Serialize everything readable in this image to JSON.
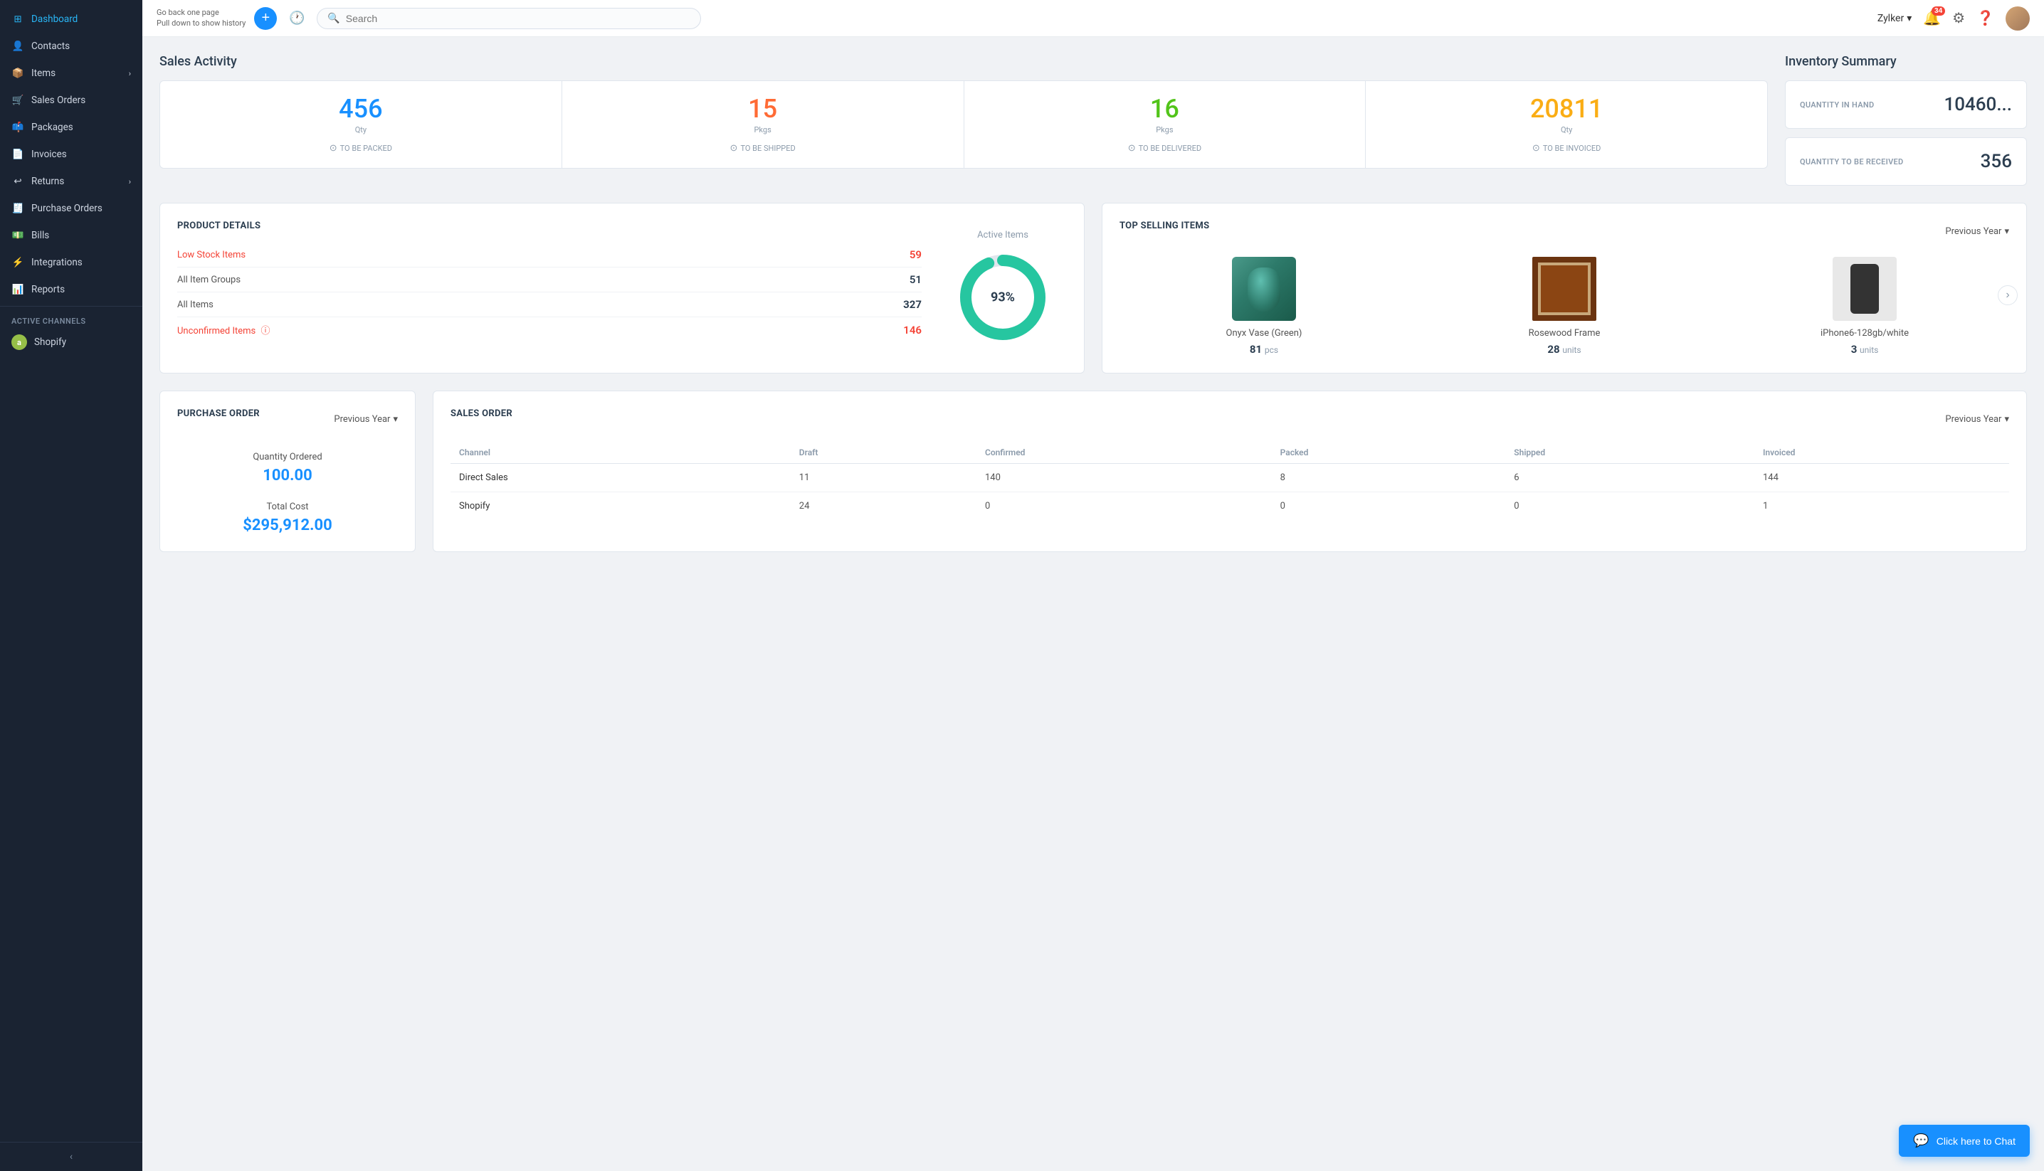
{
  "sidebar": {
    "nav_hint": "Go back one page\nPull down to show history",
    "items": [
      {
        "id": "dashboard",
        "label": "Dashboard",
        "icon": "grid",
        "active": true
      },
      {
        "id": "contacts",
        "label": "Contacts",
        "icon": "person"
      },
      {
        "id": "items",
        "label": "Items",
        "icon": "box",
        "hasSubmenu": true
      },
      {
        "id": "sales-orders",
        "label": "Sales Orders",
        "icon": "cart"
      },
      {
        "id": "packages",
        "label": "Packages",
        "icon": "package"
      },
      {
        "id": "invoices",
        "label": "Invoices",
        "icon": "file"
      },
      {
        "id": "returns",
        "label": "Returns",
        "icon": "return",
        "hasSubmenu": true
      },
      {
        "id": "purchase-orders",
        "label": "Purchase Orders",
        "icon": "purchase"
      },
      {
        "id": "bills",
        "label": "Bills",
        "icon": "bill"
      },
      {
        "id": "integrations",
        "label": "Integrations",
        "icon": "integration"
      },
      {
        "id": "reports",
        "label": "Reports",
        "icon": "report"
      }
    ],
    "active_channels_label": "ACTIVE CHANNELS",
    "channels": [
      {
        "id": "shopify",
        "label": "Shopify",
        "icon": "shopify"
      }
    ],
    "collapse_label": "‹"
  },
  "header": {
    "search_placeholder": "Search",
    "user_name": "Zylker",
    "notification_count": "34",
    "add_button_label": "+",
    "back_hint": "Go back one page\nPull down to show history"
  },
  "sales_activity": {
    "title": "Sales Activity",
    "cards": [
      {
        "number": "456",
        "label": "Qty",
        "status": "TO BE PACKED",
        "color": "blue"
      },
      {
        "number": "15",
        "label": "Pkgs",
        "status": "TO BE SHIPPED",
        "color": "orange"
      },
      {
        "number": "16",
        "label": "Pkgs",
        "status": "TO BE DELIVERED",
        "color": "green"
      },
      {
        "number": "20811",
        "label": "Qty",
        "status": "TO BE INVOICED",
        "color": "gold"
      }
    ]
  },
  "inventory_summary": {
    "title": "Inventory Summary",
    "items": [
      {
        "label": "QUANTITY IN HAND",
        "value": "10460..."
      },
      {
        "label": "QUANTITY TO BE RECEIVED",
        "value": "356"
      }
    ]
  },
  "product_details": {
    "title": "PRODUCT DETAILS",
    "rows": [
      {
        "label": "Low Stock Items",
        "value": "59",
        "label_type": "red-link",
        "value_type": "red"
      },
      {
        "label": "All Item Groups",
        "value": "51",
        "label_type": "normal",
        "value_type": "normal"
      },
      {
        "label": "All Items",
        "value": "327",
        "label_type": "normal",
        "value_type": "bold"
      },
      {
        "label": "Unconfirmed Items",
        "value": "146",
        "label_type": "red-link",
        "value_type": "red",
        "has_info": true
      }
    ],
    "donut": {
      "label": "Active Items",
      "percent": 93,
      "percent_label": "93%",
      "color_active": "#26c6a0",
      "color_inactive": "#e0e6ed"
    }
  },
  "top_selling": {
    "title": "TOP SELLING ITEMS",
    "period": "Previous Year",
    "items": [
      {
        "name": "Onyx Vase (Green)",
        "qty": "81",
        "unit": "pcs",
        "image_type": "vase"
      },
      {
        "name": "Rosewood Frame",
        "qty": "28",
        "unit": "units",
        "image_type": "frame"
      },
      {
        "name": "iPhone6-128gb/white",
        "qty": "3",
        "unit": "units",
        "image_type": "phone"
      }
    ]
  },
  "purchase_order": {
    "title": "PURCHASE ORDER",
    "period": "Previous Year",
    "metrics": [
      {
        "label": "Quantity Ordered",
        "value": "100.00"
      },
      {
        "label": "Total Cost",
        "value": "$295,912.00"
      }
    ]
  },
  "sales_order": {
    "title": "SALES ORDER",
    "period": "Previous Year",
    "columns": [
      "Channel",
      "Draft",
      "Confirmed",
      "Packed",
      "Shipped",
      "Invoiced"
    ],
    "rows": [
      {
        "channel": "Direct Sales",
        "draft": "11",
        "confirmed": "140",
        "packed": "8",
        "shipped": "6",
        "invoiced": "144"
      },
      {
        "channel": "Shopify",
        "draft": "24",
        "confirmed": "0",
        "packed": "0",
        "shipped": "0",
        "invoiced": "1"
      }
    ]
  },
  "chat": {
    "label": "Click here to Chat"
  }
}
